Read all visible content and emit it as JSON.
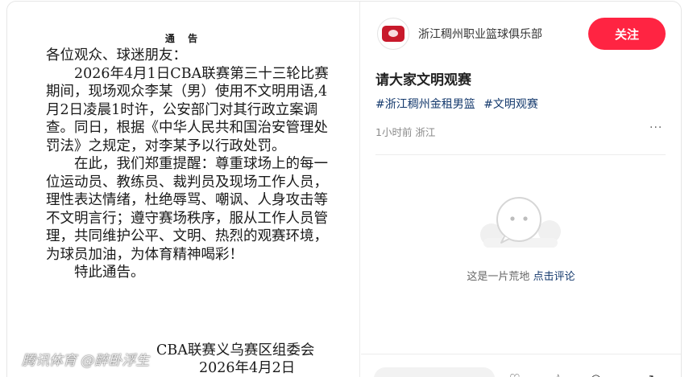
{
  "notice": {
    "title": "通 告",
    "salutation": "各位观众、球迷朋友：",
    "para1": "2026年4月1日CBA联赛第三十三轮比赛期间，现场观众李某（男）使用不文明用语,4月2日凌晨1时许，公安部门对其行政立案调查。同日，根据《中华人民共和国治安管理处罚法》之规定，对李某予以行政处罚。",
    "para2": "在此，我们郑重提醒：尊重球场上的每一位运动员、教练员、裁判员及现场工作人员，理性表达情绪，杜绝辱骂、嘲讽、人身攻击等不文明言行；遵守赛场秩序，服从工作人员管理，共同维护公平、文明、热烈的观赛环境，为球员加油，为体育精神喝彩！",
    "para3": "特此通告。",
    "signature": "CBA联赛义乌赛区组委会",
    "date": "2026年4月2日",
    "watermark": "腾讯体育 @醉卧浮生"
  },
  "post": {
    "author": "浙江稠州职业篮球俱乐部",
    "follow_label": "关注",
    "title": "请大家文明观赛",
    "tags": [
      "#浙江稠州金租男篮",
      "#文明观赛"
    ],
    "meta": "1小时前 浙江",
    "more": "···",
    "empty_text": "这是一片荒地",
    "empty_link": "点击评论"
  },
  "colors": {
    "accent": "#ff2442",
    "tag_link": "#13386c"
  }
}
